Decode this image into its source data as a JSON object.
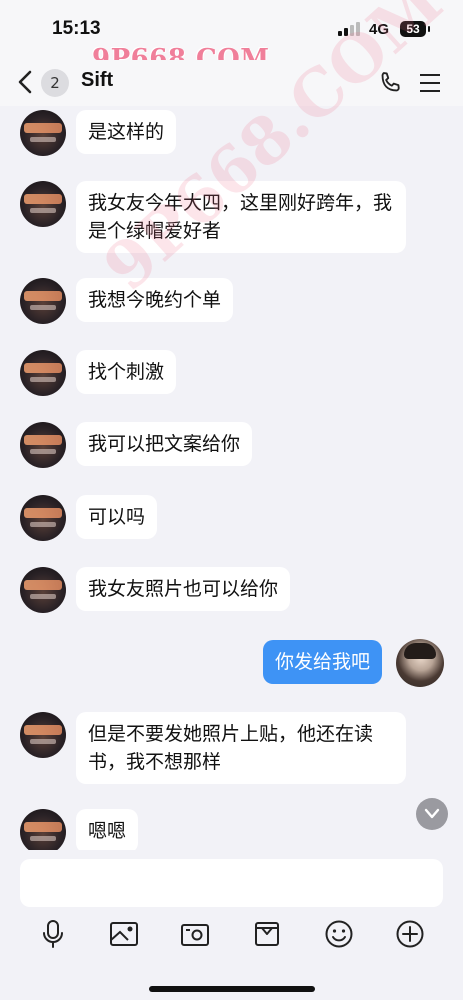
{
  "status_bar": {
    "time": "15:13",
    "network": "4G",
    "battery": "53"
  },
  "watermark": "9P668.COM",
  "watermark_diagonal": "9P668.COM",
  "header": {
    "unread_count": "2",
    "title": "Sift"
  },
  "messages": [
    {
      "from": "other",
      "text": "是这样的"
    },
    {
      "from": "other",
      "text": "我女友今年大四，这里刚好跨年，我是个绿帽爱好者"
    },
    {
      "from": "other",
      "text": "我想今晚约个单"
    },
    {
      "from": "other",
      "text": "找个刺激"
    },
    {
      "from": "other",
      "text": "我可以把文案给你"
    },
    {
      "from": "other",
      "text": "可以吗"
    },
    {
      "from": "other",
      "text": "我女友照片也可以给你"
    },
    {
      "from": "me",
      "text": "你发给我吧"
    },
    {
      "from": "other",
      "text": "但是不要发她照片上贴，他还在读书，我不想那样"
    },
    {
      "from": "other",
      "text": "嗯嗯"
    }
  ],
  "composer": {
    "value": "",
    "placeholder": ""
  },
  "toolbar_icons": [
    "microphone-icon",
    "image-icon",
    "camera-icon",
    "gift-icon",
    "emoji-icon",
    "plus-icon"
  ],
  "colors": {
    "outgoing_bubble": "#3e93f5",
    "incoming_bubble": "#ffffff",
    "background": "#f2f2f7",
    "watermark": "#f07f9a"
  }
}
